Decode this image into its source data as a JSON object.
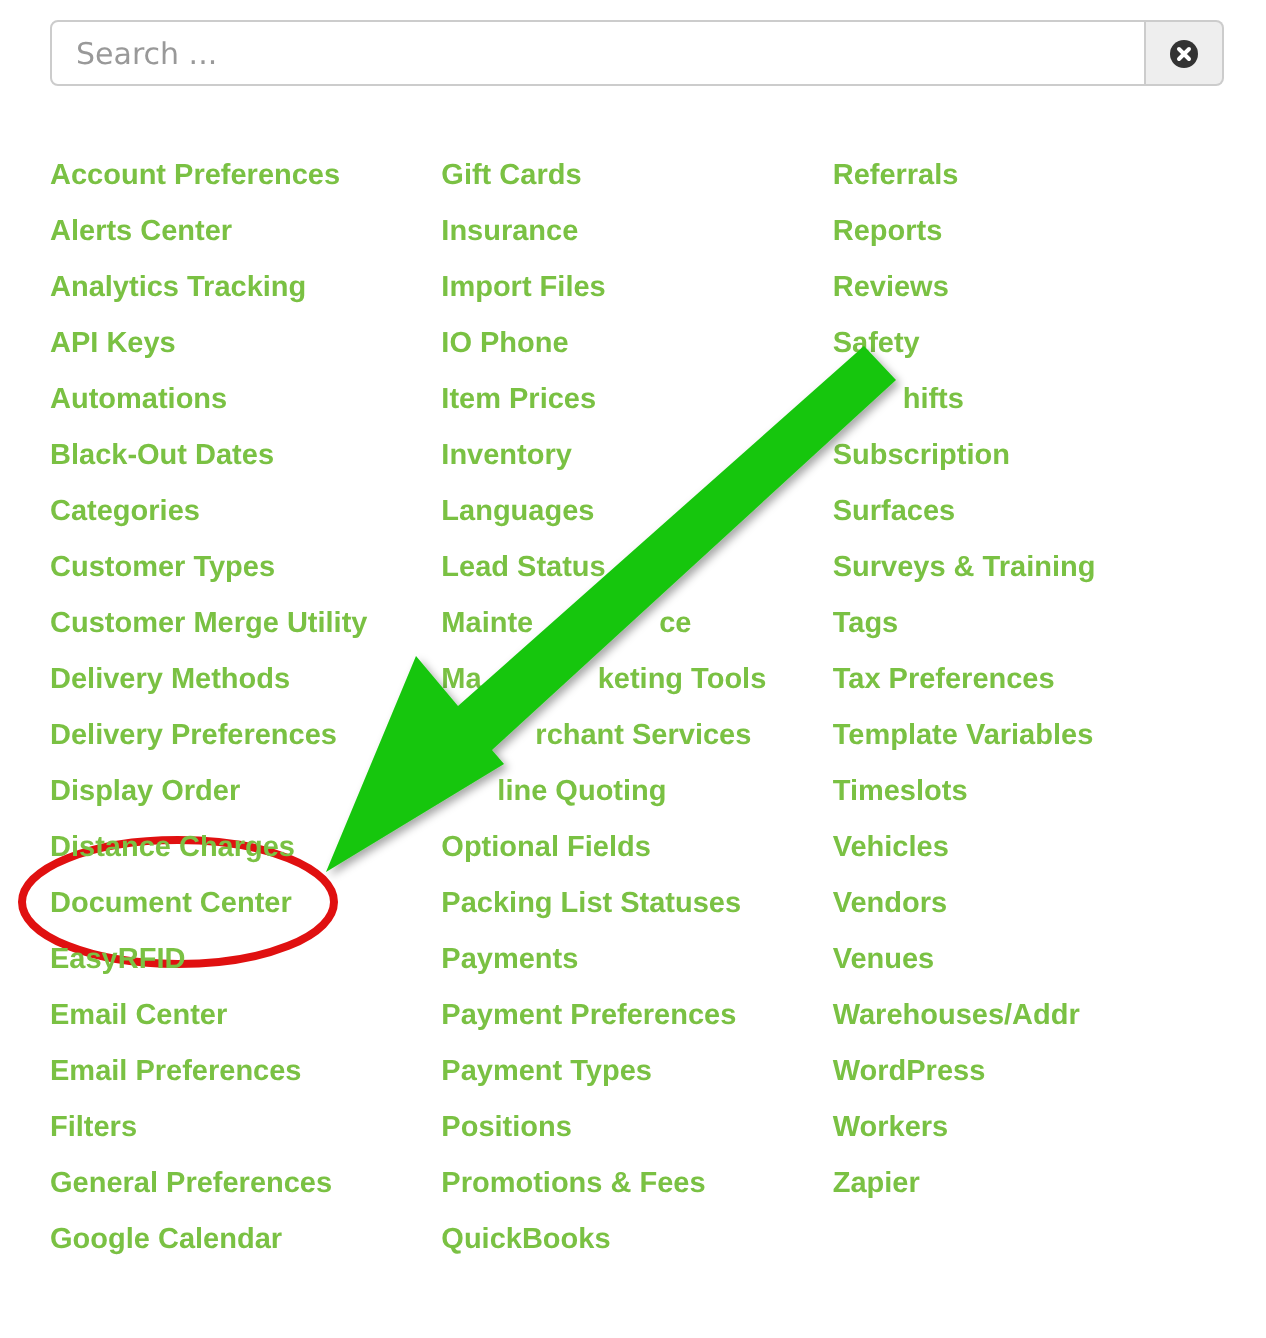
{
  "search": {
    "placeholder": "Search ..."
  },
  "columns": [
    [
      "Account Preferences",
      "Alerts Center",
      "Analytics Tracking",
      "API Keys",
      "Automations",
      "Black-Out Dates",
      "Categories",
      "Customer Types",
      "Customer Merge Utility",
      "Delivery Methods",
      "Delivery Preferences",
      "Display Order",
      "Distance Charges",
      "Document Center",
      "EasyRFID",
      "Email Center",
      "Email Preferences",
      "Filters",
      "General Preferences",
      "Google Calendar"
    ],
    [
      "Gift Cards",
      "Insurance",
      "Import Files",
      "IO Phone",
      "Item Prices",
      "Inventory",
      "Languages",
      {
        "kind": "covered_end",
        "parts": [
          "Lead Status"
        ]
      },
      {
        "kind": "covered_middle",
        "parts": [
          "Mainte",
          "ce"
        ]
      },
      {
        "kind": "covered_middle",
        "parts": [
          "Ma",
          "keting Tools"
        ]
      },
      {
        "kind": "covered_start",
        "parts": [
          "rchant Services"
        ]
      },
      {
        "kind": "covered_start",
        "parts": [
          "line Quoting"
        ]
      },
      "Optional Fields",
      "Packing List Statuses",
      "Payments",
      "Payment Preferences",
      "Payment Types",
      "Positions",
      "Promotions & Fees",
      "QuickBooks"
    ],
    [
      "Referrals",
      "Reports",
      "Reviews",
      "Safety",
      {
        "kind": "covered_start",
        "parts": [
          "hifts"
        ]
      },
      "Subscription",
      "Surfaces",
      "Surveys & Training",
      "Tags",
      "Tax Preferences",
      "Template Variables",
      "Timeslots",
      "Vehicles",
      "Vendors",
      "Venues",
      "Warehouses/Addr",
      "WordPress",
      "Workers",
      "Zapier"
    ]
  ]
}
